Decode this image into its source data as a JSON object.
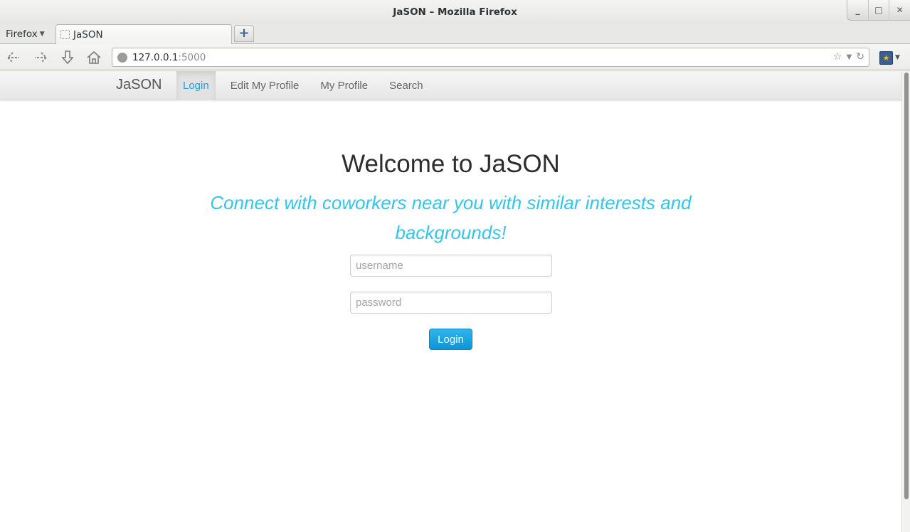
{
  "window": {
    "title": "JaSON – Mozilla Firefox",
    "controls": {
      "minimize": "_",
      "maximize": "□",
      "close": "✕"
    }
  },
  "browser": {
    "menu_label": "Firefox",
    "tab": {
      "title": "JaSON"
    },
    "new_tab_label": "+",
    "url": {
      "host": "127.0.0.1",
      "port": ":5000"
    },
    "icons": [
      "back-icon",
      "forward-icon",
      "download-icon",
      "home-icon",
      "globe-icon",
      "star-icon",
      "dropdown-icon",
      "reload-icon",
      "bookmarks-icon"
    ]
  },
  "site": {
    "brand": "JaSON",
    "nav": [
      {
        "label": "Login",
        "active": true
      },
      {
        "label": "Edit My Profile",
        "active": false
      },
      {
        "label": "My Profile",
        "active": false
      },
      {
        "label": "Search",
        "active": false
      }
    ]
  },
  "main": {
    "title": "Welcome to JaSON",
    "subtitle": "Connect with coworkers near you with similar interests and backgrounds!",
    "username": {
      "value": "",
      "placeholder": "username"
    },
    "password": {
      "value": "",
      "placeholder": "password"
    },
    "login_button": "Login"
  },
  "colors": {
    "accent": "#33c5ec",
    "button": "#1ba5e0",
    "active_nav": "#1aa1d9"
  }
}
